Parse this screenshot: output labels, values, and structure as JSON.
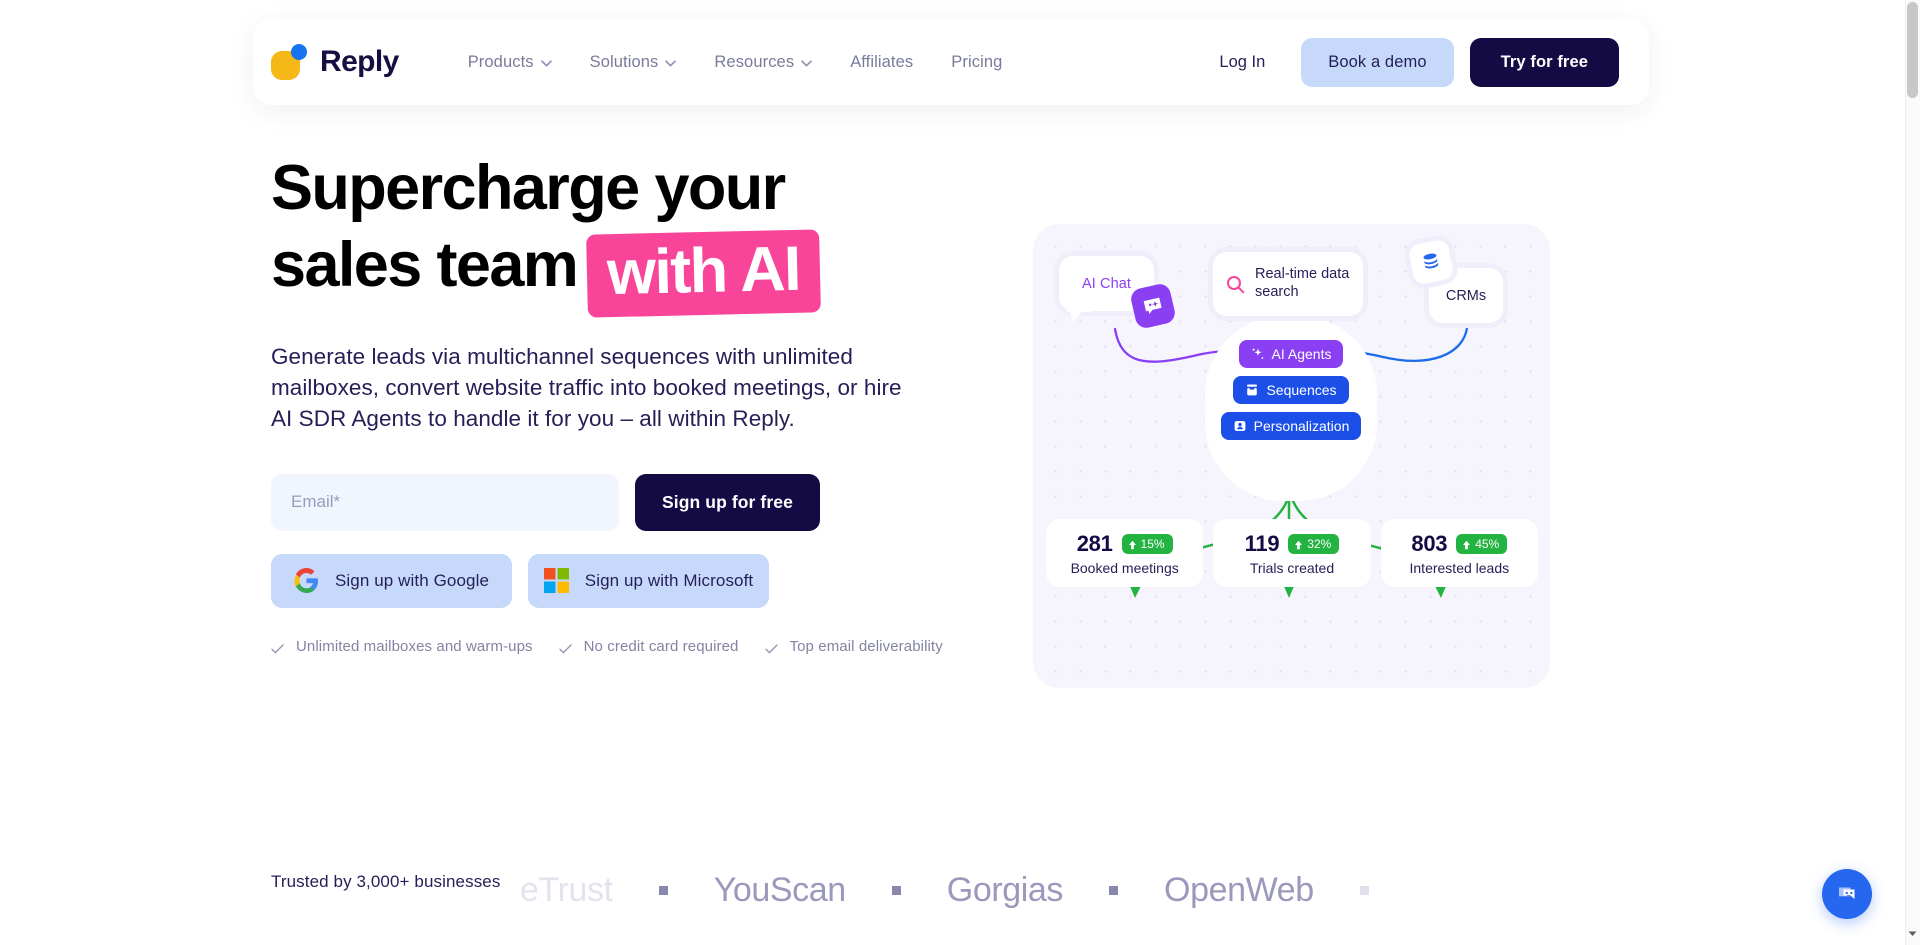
{
  "brand": {
    "name": "Reply",
    "logo_icon": "reply-logo-icon",
    "yellow": "#F5B816",
    "blue": "#1773F0"
  },
  "nav": {
    "links": [
      {
        "label": "Products",
        "has_dropdown": true
      },
      {
        "label": "Solutions",
        "has_dropdown": true
      },
      {
        "label": "Resources",
        "has_dropdown": true
      },
      {
        "label": "Affiliates",
        "has_dropdown": false
      },
      {
        "label": "Pricing",
        "has_dropdown": false
      }
    ],
    "login_label": "Log In",
    "demo_label": "Book a demo",
    "try_label": "Try for free"
  },
  "hero": {
    "headline_line1": "Supercharge your",
    "headline_line2": "sales team",
    "headline_highlight": "with AI",
    "highlight_color": "#F8459A",
    "subhead": "Generate leads via multichannel sequences with unlimited mailboxes, convert website traffic into booked meetings, or hire AI SDR Agents to handle it for you – all within Reply.",
    "email_placeholder": "Email*",
    "email_value": "",
    "signup_label": "Sign up for free",
    "google_label": "Sign up with Google",
    "microsoft_label": "Sign up with Microsoft",
    "checks": [
      "Unlimited mailboxes and warm-ups",
      "No credit card required",
      "Top email deliverability"
    ]
  },
  "illustration": {
    "nodes": {
      "ai_chat": {
        "label": "AI Chat",
        "color": "#8B3FF3",
        "icon": "chat-sparkle-icon"
      },
      "search": {
        "label": "Real-time data search",
        "icon": "magnifier-icon",
        "icon_color": "#F8459A"
      },
      "crms": {
        "label": "CRMs",
        "icon": "database-icon",
        "icon_color": "#2667EF"
      }
    },
    "pills": [
      {
        "label": "AI Agents",
        "color": "#8B3FF3",
        "icon": "sparkle-icon"
      },
      {
        "label": "Sequences",
        "color": "#1B4FE8",
        "icon": "inbox-icon"
      },
      {
        "label": "Personalization",
        "color": "#1B4FE8",
        "icon": "contact-card-icon"
      }
    ],
    "stats": [
      {
        "value": "281",
        "delta": "15%",
        "label": "Booked meetings",
        "trend": "up"
      },
      {
        "value": "119",
        "delta": "32%",
        "label": "Trials created",
        "trend": "up"
      },
      {
        "value": "803",
        "delta": "45%",
        "label": "Interested leads",
        "trend": "up"
      }
    ],
    "stat_badge_color": "#23B341"
  },
  "trust": {
    "label": "Trusted by 3,000+ businesses",
    "logos": [
      "eTrust",
      "YouScan",
      "Gorgias",
      "OpenWeb"
    ]
  },
  "chat_widget": {
    "icon": "chat-bubble-smiley-icon",
    "color": "#2667EF"
  }
}
